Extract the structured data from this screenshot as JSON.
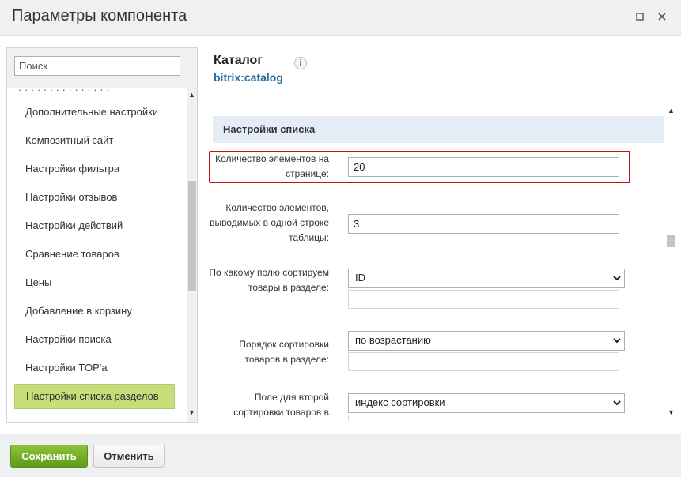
{
  "window": {
    "title": "Параметры компонента",
    "maximize_icon": "maximize-icon",
    "close_icon": "close-icon"
  },
  "sidebar": {
    "search_placeholder": "Поиск",
    "items": [
      {
        "label": "Дополнительные настройки",
        "active": false
      },
      {
        "label": "Композитный сайт",
        "active": false
      },
      {
        "label": "Настройки фильтра",
        "active": false
      },
      {
        "label": "Настройки отзывов",
        "active": false
      },
      {
        "label": "Настройки действий",
        "active": false
      },
      {
        "label": "Сравнение товаров",
        "active": false
      },
      {
        "label": "Цены",
        "active": false
      },
      {
        "label": "Добавление в корзину",
        "active": false
      },
      {
        "label": "Настройки поиска",
        "active": false
      },
      {
        "label": "Настройки TOP'а",
        "active": false
      },
      {
        "label": "Настройки списка разделов",
        "active": true
      }
    ],
    "active_color": "#c6dd7a"
  },
  "component": {
    "title": "Каталог",
    "code": "bitrix:catalog",
    "info_icon": "info-icon"
  },
  "section": {
    "title": "Настройки списка"
  },
  "fields": {
    "page_element_count": {
      "label": "Количество элементов на странице:",
      "value": "20"
    },
    "line_element_count": {
      "label": "Количество элементов, выводимых в одной строке таблицы:",
      "value": "3"
    },
    "sort_field": {
      "label": "По какому полю сортируем товары в разделе:",
      "value": "ID",
      "extra": ""
    },
    "sort_order": {
      "label": "Порядок сортировки товаров в разделе:",
      "value": "по возрастанию",
      "extra": ""
    },
    "sort_field2": {
      "label": "Поле для второй сортировки товаров в",
      "value": "индекс сортировки",
      "extra": ""
    }
  },
  "footer": {
    "save_label": "Сохранить",
    "cancel_label": "Отменить"
  },
  "colors": {
    "highlight": "#c0141b",
    "save_button": "#6fae24",
    "link": "#2a6c9c"
  }
}
